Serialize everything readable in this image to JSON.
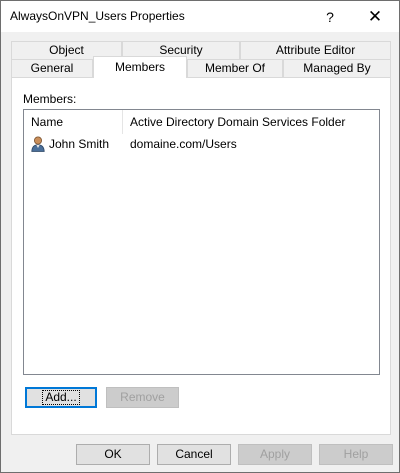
{
  "window": {
    "title": "AlwaysOnVPN_Users Properties",
    "help_glyph": "?",
    "close_glyph": "✕"
  },
  "tabs": {
    "row1": [
      "Object",
      "Security",
      "Attribute Editor"
    ],
    "row2": [
      "General",
      "Members",
      "Member Of",
      "Managed By"
    ],
    "selected": "Members"
  },
  "members": {
    "label": "Members:",
    "columns": [
      "Name",
      "Active Directory Domain Services Folder"
    ],
    "rows": [
      {
        "name": "John Smith",
        "folder": "domaine.com/Users",
        "icon": "user-icon"
      }
    ]
  },
  "list_buttons": {
    "add": "Add...",
    "remove": "Remove",
    "remove_enabled": false
  },
  "dialog_buttons": {
    "ok": "OK",
    "cancel": "Cancel",
    "apply": "Apply",
    "apply_enabled": false,
    "help": "Help",
    "help_enabled": false
  },
  "colors": {
    "accent": "#0078d7",
    "dialog_bg": "#f0f0f0",
    "disabled_text": "#a0a0a0"
  }
}
